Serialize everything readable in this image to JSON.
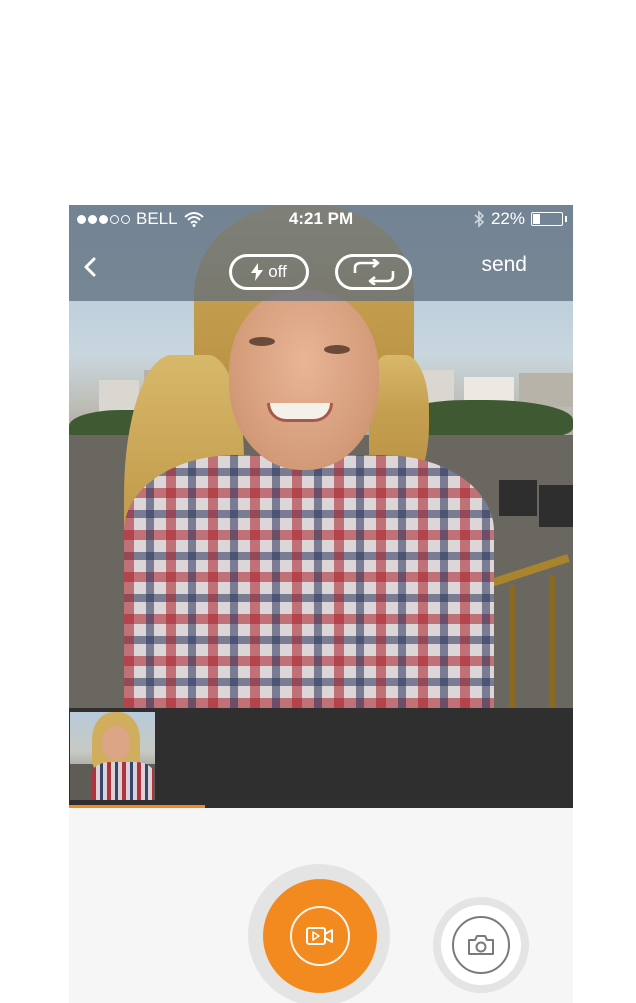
{
  "status_bar": {
    "carrier": "BELL",
    "time": "4:21 PM",
    "battery_percent": "22%",
    "battery_level": 0.22,
    "signal_bars_filled": 3,
    "signal_bars_total": 5,
    "icons": [
      "wifi-icon",
      "bluetooth-icon",
      "battery-icon"
    ]
  },
  "top_bar": {
    "back_icon": "chevron-left-icon",
    "flash_icon": "lightning-bolt-icon",
    "flash_label": "off",
    "flip_camera_icon": "switch-camera-icon",
    "send_label": "send"
  },
  "clips": {
    "count": 1,
    "recording_progress": 0.27
  },
  "controls": {
    "record_icon": "video-camera-icon",
    "photo_icon": "camera-icon"
  },
  "colors": {
    "accent": "#f28a1f",
    "strip_background": "#2f2f2f",
    "bar_overlay": "#606e7c",
    "controls_background": "#f6f6f6"
  }
}
